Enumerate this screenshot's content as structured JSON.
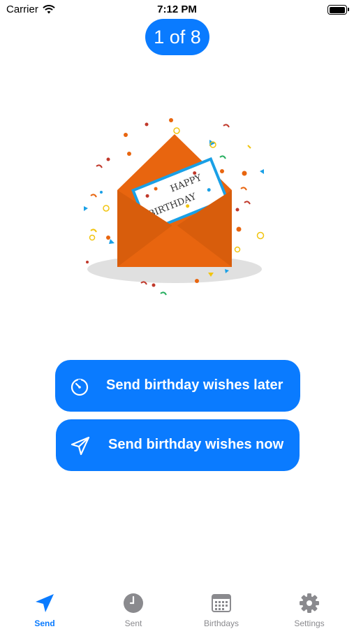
{
  "status_bar": {
    "carrier": "Carrier",
    "time": "7:12 PM",
    "battery_level": 1.0
  },
  "counter": {
    "label": "1 of 8"
  },
  "illustration": {
    "card_line1": "HAPPY",
    "card_line2": "BIRTHDAY",
    "envelope_color": "#e8650f",
    "card_border_color": "#1aa0e6"
  },
  "actions": {
    "later": {
      "label": "Send birthday wishes later",
      "icon": "timer-icon"
    },
    "now": {
      "label": "Send birthday wishes now",
      "icon": "paper-plane-icon"
    }
  },
  "tab_bar": {
    "active": "Send",
    "items": [
      {
        "label": "Send",
        "icon": "paper-plane-icon"
      },
      {
        "label": "Sent",
        "icon": "clock-icon"
      },
      {
        "label": "Birthdays",
        "icon": "calendar-icon"
      },
      {
        "label": "Settings",
        "icon": "gear-icon"
      }
    ]
  },
  "colors": {
    "accent": "#0a7bff",
    "inactive": "#8a8a8e",
    "background": "#ffffff"
  }
}
